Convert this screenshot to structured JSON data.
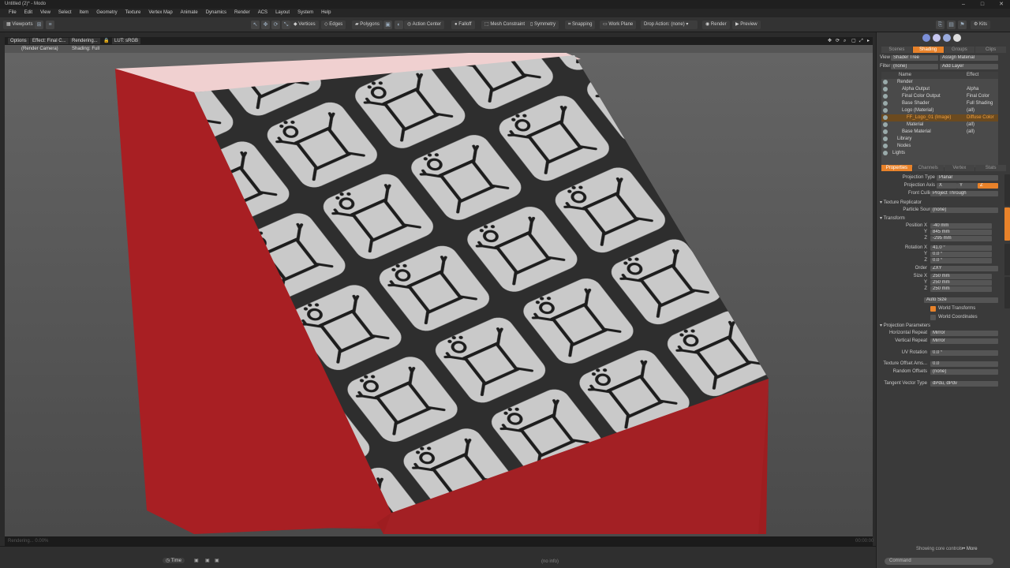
{
  "window": {
    "title": "Untitled (2)* - Modo",
    "controls": [
      "–",
      "□",
      "✕"
    ]
  },
  "menu": [
    "File",
    "Edit",
    "View",
    "Select",
    "Item",
    "Geometry",
    "Texture",
    "Vertex Map",
    "Animate",
    "Dynamics",
    "Render",
    "ACS",
    "Layout",
    "System",
    "Help"
  ],
  "toolbar": {
    "viewports": "Viewports",
    "vertices": "Vertices",
    "edges": "Edges",
    "polygons": "Polygons",
    "action_center": "Action Center",
    "falloff": "Falloff",
    "mesh_constraint": "Mesh Constraint",
    "symmetry": "Symmetry",
    "snapping": "Snapping",
    "work_plane": "Work Plane",
    "drop_action": "Drop Action: (none)",
    "render": "Render",
    "preview": "Preview",
    "kits": "Kits"
  },
  "viewport": {
    "options": "Options",
    "effect": "Effect: Final C...",
    "rendering": "Rendering...",
    "lut": "LUT: sRGB",
    "camera": "(Render Camera)",
    "shading": "Shading: Full",
    "status_left": "Rendering... 0.00%",
    "time_right": "00:00:00",
    "colors": {
      "box_red": "#a51f22",
      "tile_bg": "#c9c9c9",
      "tile_gap": "#2e2e2e"
    }
  },
  "statusbar": {
    "time": "Time",
    "no_info": "(no info)",
    "showing": "Showing core controls",
    "more": "More"
  },
  "panel": {
    "top_tabs": [
      "Scenes",
      "Shading",
      "Groups",
      "Clips"
    ],
    "active_top": 1,
    "view_label": "View",
    "view_value": "Shader Tree",
    "assign": "Assign Material",
    "filter_label": "Filter",
    "filter_value": "(none)",
    "add_layer": "Add Layer",
    "col_name": "Name",
    "col_effect": "Effect",
    "tree": [
      {
        "name": "Render",
        "effect": "",
        "indent": 1,
        "sel": false
      },
      {
        "name": "Alpha Output",
        "effect": "Alpha",
        "indent": 2,
        "sel": false
      },
      {
        "name": "Final Color Output",
        "effect": "Final Color",
        "indent": 2,
        "sel": false
      },
      {
        "name": "Base Shader",
        "effect": "Full Shading",
        "indent": 2,
        "sel": false
      },
      {
        "name": "Logo (Material)",
        "effect": "(all)",
        "indent": 2,
        "sel": false
      },
      {
        "name": "FF_Logo_01 (Image)",
        "effect": "Diffuse Color",
        "indent": 3,
        "sel": true
      },
      {
        "name": "Material",
        "effect": "(all)",
        "indent": 3,
        "sel": false
      },
      {
        "name": "Base Material",
        "effect": "(all)",
        "indent": 2,
        "sel": false
      },
      {
        "name": "Library",
        "effect": "",
        "indent": 1,
        "sel": false
      },
      {
        "name": "Nodes",
        "effect": "",
        "indent": 1,
        "sel": false
      },
      {
        "name": "Lights",
        "effect": "",
        "indent": 0,
        "sel": false
      }
    ],
    "prop_tabs": [
      "Properties",
      "Channels",
      "Vertex",
      "Stats"
    ],
    "active_prop": 0,
    "props": {
      "projection_type_l": "Projection Type",
      "projection_type": "Planar",
      "projection_axis_l": "Projection Axis",
      "axis_x": "X",
      "axis_y": "Y",
      "axis_z": "Z",
      "front_culling_l": "Front Culling",
      "front_culling": "Project Through",
      "texture_replicator": "Texture Replicator",
      "particle_source_l": "Particle Source",
      "particle_source": "(none)",
      "transform": "Transform",
      "position_l": "Position X",
      "pos_x": "-40 mm",
      "pos_y": "845 mm",
      "pos_z": "-295 mm",
      "rotation_l": "Rotation X",
      "rot_x": "41.0 °",
      "rot_y": "0.0 °",
      "rot_z": "0.0 °",
      "order_l": "Order",
      "order": "ZXY",
      "size_l": "Size X",
      "size_x": "250 mm",
      "size_y": "250 mm",
      "size_z": "250 mm",
      "auto_size": "Auto Size",
      "world_transforms": "World Transforms",
      "world_coordinates": "World Coordinates",
      "projection_params": "Projection Parameters",
      "h_repeat_l": "Horizontal Repeat",
      "h_repeat": "Mirror",
      "v_repeat_l": "Vertical Repeat",
      "v_repeat": "Mirror",
      "uv_rotation_l": "UV Rotation",
      "uv_rotation": "0.0 °",
      "tex_offset_l": "Texture Offset Ams...",
      "tex_offset": "0.0",
      "random_offsets_l": "Random Offsets",
      "random_offsets": "(none)",
      "tangent_l": "Tangent Vector Type",
      "tangent": "dPdu, dPdv"
    },
    "side_tabs": [
      "Shader Item",
      "Texture Locator",
      "Texture Layer",
      "Use Profile"
    ],
    "command": "Command"
  }
}
